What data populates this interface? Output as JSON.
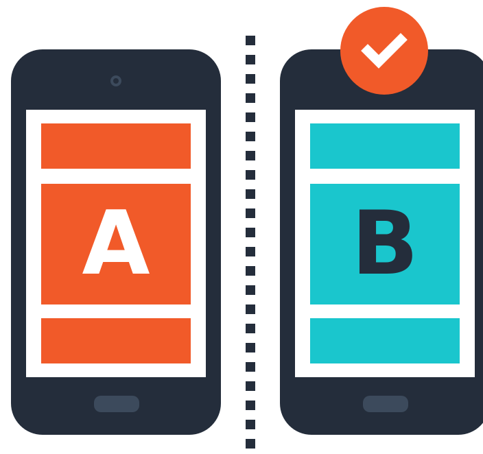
{
  "colors": {
    "body": "#242d3b",
    "screen": "#ffffff",
    "orange": "#f15a29",
    "teal": "#1ac6cd",
    "accent_soft": "#3c4a5c",
    "letter_a": "#ffffff",
    "letter_b": "#242d3b",
    "check": "#ffffff"
  },
  "variant_a": {
    "letter": "A"
  },
  "variant_b": {
    "letter": "B"
  },
  "icons": {
    "selected_badge": "check-circle-icon",
    "divider": "dotted-divider"
  }
}
